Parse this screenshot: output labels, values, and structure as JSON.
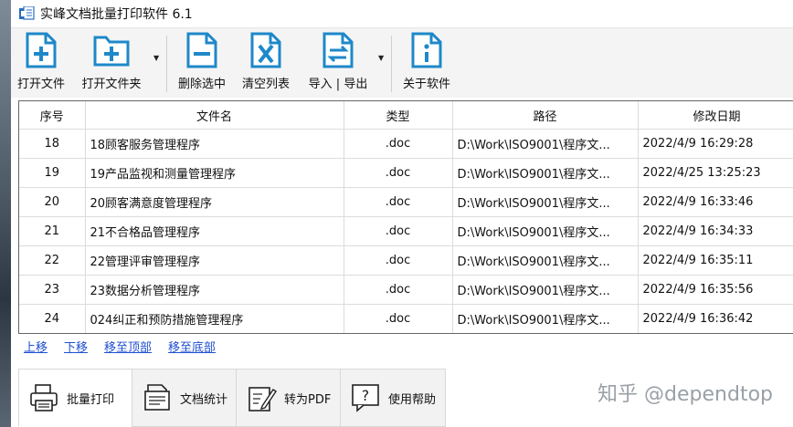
{
  "window": {
    "title": "实峰文档批量打印软件 6.1"
  },
  "toolbar": {
    "open_file": "打开文件",
    "open_folder": "打开文件夹",
    "delete_selected": "删除选中",
    "clear_list": "清空列表",
    "import_export": "导入 | 导出",
    "about": "关于软件"
  },
  "table": {
    "columns": [
      "序号",
      "文件名",
      "类型",
      "路径",
      "修改日期"
    ],
    "rows": [
      {
        "no": "18",
        "name": "18顾客服务管理程序",
        "type": ".doc",
        "path": "D:\\Work\\ISO9001\\程序文...",
        "date": "2022/4/9 16:29:28"
      },
      {
        "no": "19",
        "name": "19产品监视和测量管理程序",
        "type": ".doc",
        "path": "D:\\Work\\ISO9001\\程序文...",
        "date": "2022/4/25 13:25:23"
      },
      {
        "no": "20",
        "name": "20顾客满意度管理程序",
        "type": ".doc",
        "path": "D:\\Work\\ISO9001\\程序文...",
        "date": "2022/4/9 16:33:46"
      },
      {
        "no": "21",
        "name": "21不合格品管理程序",
        "type": ".doc",
        "path": "D:\\Work\\ISO9001\\程序文...",
        "date": "2022/4/9 16:34:33"
      },
      {
        "no": "22",
        "name": "22管理评审管理程序",
        "type": ".doc",
        "path": "D:\\Work\\ISO9001\\程序文...",
        "date": "2022/4/9 16:35:11"
      },
      {
        "no": "23",
        "name": "23数据分析管理程序",
        "type": ".doc",
        "path": "D:\\Work\\ISO9001\\程序文...",
        "date": "2022/4/9 16:35:56"
      },
      {
        "no": "24",
        "name": "024纠正和预防措施管理程序",
        "type": ".doc",
        "path": "D:\\Work\\ISO9001\\程序文...",
        "date": "2022/4/9 16:36:42"
      }
    ]
  },
  "nav": {
    "up": "上移",
    "down": "下移",
    "top": "移至顶部",
    "bottom": "移至底部"
  },
  "tabs": {
    "batch_print": "批量打印",
    "doc_stats": "文档统计",
    "to_pdf": "转为PDF",
    "help": "使用帮助"
  },
  "watermark": "知乎 @dependtop",
  "colors": {
    "icon_accent": "#1e88c9",
    "link": "#1f4fd1"
  }
}
